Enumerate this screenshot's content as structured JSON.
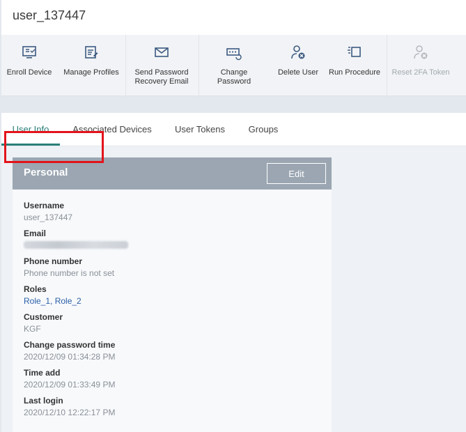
{
  "page": {
    "title": "user_137447"
  },
  "toolbar": {
    "items": [
      {
        "label": "Enroll Device",
        "icon": "enroll-device-icon"
      },
      {
        "label": "Manage Profiles",
        "icon": "manage-profiles-icon"
      },
      {
        "label": "Send Password\nRecovery Email",
        "icon": "envelope-icon"
      },
      {
        "label": "Change\nPassword",
        "icon": "change-password-icon"
      },
      {
        "label": "Delete User",
        "icon": "delete-user-icon"
      },
      {
        "label": "Run Procedure",
        "icon": "run-procedure-icon"
      },
      {
        "label": "Reset 2FA Token",
        "icon": "reset-2fa-icon",
        "disabled": true
      }
    ]
  },
  "tabs": [
    {
      "label": "User Info",
      "active": true
    },
    {
      "label": "Associated Devices"
    },
    {
      "label": "User Tokens"
    },
    {
      "label": "Groups"
    }
  ],
  "personal": {
    "title": "Personal",
    "edit_label": "Edit",
    "fields": {
      "username": {
        "label": "Username",
        "value": "user_137447"
      },
      "email": {
        "label": "Email"
      },
      "phone": {
        "label": "Phone number",
        "value": "Phone number is not set"
      },
      "roles": {
        "label": "Roles",
        "value": "Role_1, Role_2"
      },
      "customer": {
        "label": "Customer",
        "value": "KGF"
      },
      "change_password_time": {
        "label": "Change password time",
        "value": "2020/12/09 01:34:28 PM"
      },
      "time_add": {
        "label": "Time add",
        "value": "2020/12/09 01:33:49 PM"
      },
      "last_login": {
        "label": "Last login",
        "value": "2020/12/10 12:22:17 PM"
      }
    }
  },
  "colors": {
    "accent": "#2a7f77",
    "link": "#2a5ea8",
    "card_header": "#9ba6b2",
    "highlight": "#e3131b"
  }
}
